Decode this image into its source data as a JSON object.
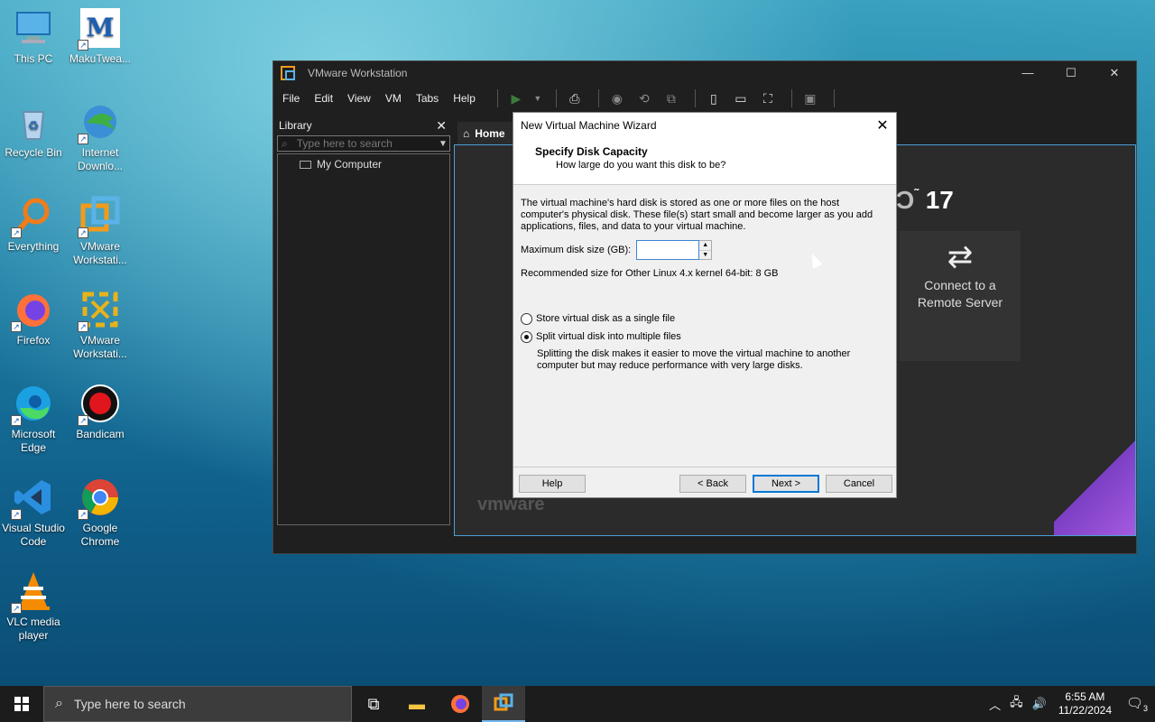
{
  "desktop": {
    "icons": [
      {
        "label": "This PC",
        "icon": "computer-icon"
      },
      {
        "label": "MakuTwea...",
        "icon": "makutweaker-icon"
      },
      {
        "label": "Recycle Bin",
        "icon": "recycle-bin-icon"
      },
      {
        "label": "Internet Downlo...",
        "icon": "idm-icon"
      },
      {
        "label": "Everything",
        "icon": "everything-search-icon"
      },
      {
        "label": "VMware Workstati...",
        "icon": "vmware-icon"
      },
      {
        "label": "Firefox",
        "icon": "firefox-icon"
      },
      {
        "label": "VMware Workstati...",
        "icon": "vmware-player-icon"
      },
      {
        "label": "Microsoft Edge",
        "icon": "edge-icon"
      },
      {
        "label": "Bandicam",
        "icon": "bandicam-icon"
      },
      {
        "label": "Visual Studio Code",
        "icon": "vscode-icon"
      },
      {
        "label": "Google Chrome",
        "icon": "chrome-icon"
      },
      {
        "label": "VLC media player",
        "icon": "vlc-icon"
      }
    ]
  },
  "vmware": {
    "title": "VMware Workstation",
    "menu": [
      "File",
      "Edit",
      "View",
      "VM",
      "Tabs",
      "Help"
    ],
    "library": {
      "title": "Library",
      "search_placeholder": "Type here to search",
      "tree": [
        "My Computer"
      ]
    },
    "home_tab": "Home",
    "version_fragment": "17",
    "remote_card": {
      "line1": "Connect to a",
      "line2": "Remote Server"
    },
    "brand_word": "vmware",
    "colors": {
      "accent": "#4aa0d8",
      "logo_orange": "#f29b1b",
      "purple": "#7b3fc4"
    }
  },
  "wizard": {
    "title": "New Virtual Machine Wizard",
    "heading": "Specify Disk Capacity",
    "subheading": "How large do you want this disk to be?",
    "description": "The virtual machine's hard disk is stored as one or more files on the host computer's physical disk. These file(s) start small and become larger as you add applications, files, and data to your virtual machine.",
    "disk_label": "Maximum disk size (GB):",
    "disk_value": "",
    "recommended": "Recommended size for Other Linux 4.x kernel 64-bit: 8 GB",
    "options": [
      {
        "label": "Store virtual disk as a single file",
        "selected": false
      },
      {
        "label": "Split virtual disk into multiple files",
        "selected": true
      }
    ],
    "split_note": "Splitting the disk makes it easier to move the virtual machine to another computer but may reduce performance with very large disks.",
    "buttons": {
      "help": "Help",
      "back": "< Back",
      "next": "Next >",
      "cancel": "Cancel"
    }
  },
  "taskbar": {
    "search_placeholder": "Type here to search",
    "time": "6:55 AM",
    "date": "11/22/2024",
    "notification_count": "3"
  }
}
